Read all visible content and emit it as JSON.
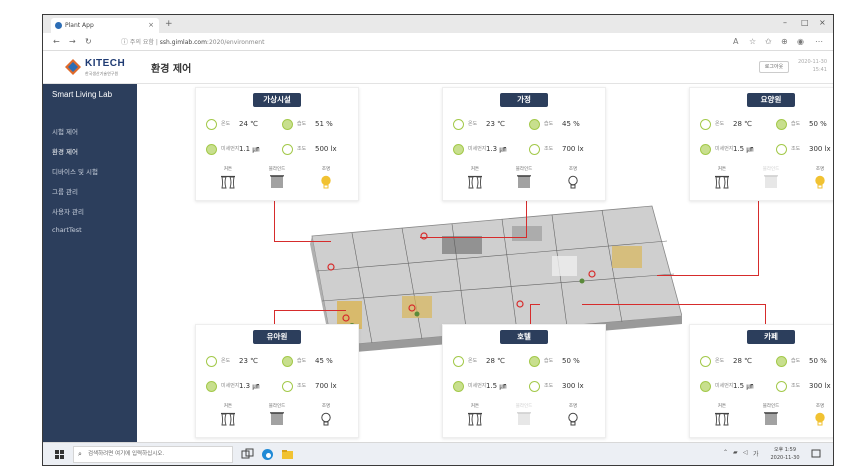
{
  "browser": {
    "tab_title": "Plant App",
    "tab_close": "×",
    "new_tab": "+",
    "window_controls": [
      "–",
      "□",
      "×"
    ],
    "nav": [
      "←",
      "→",
      "↻"
    ],
    "security_text": "주의 요함",
    "url_domain": "ssh.gimlab.com",
    "url_path": ":2020/environment"
  },
  "app": {
    "logo_text": "KITECH",
    "logo_sub": "한국생산기술연구원",
    "page_title": "환경 제어",
    "logout_label": "로그아웃",
    "date_line1": "2020-11-30",
    "date_line2": "15:41"
  },
  "sidebar": {
    "title": "Smart Living Lab",
    "items": [
      {
        "label": "시험 제어"
      },
      {
        "label": "환경 제어"
      },
      {
        "label": "디바이스 및 시험"
      },
      {
        "label": "그룹 관리"
      },
      {
        "label": "사용자 관리"
      },
      {
        "label": "chartTest"
      }
    ],
    "active_index": 1
  },
  "metric_labels": {
    "temp": "온도",
    "humidity": "습도",
    "dust": "미세먼지",
    "illum": "조도"
  },
  "device_labels": {
    "curtain": "커튼",
    "blind": "블라인드",
    "light": "조명"
  },
  "rooms": [
    {
      "name": "가상시설",
      "temp": "24 ℃",
      "humidity": "51 %",
      "dust": "1.1 ㎛",
      "illum": "500 lx",
      "curtain": true,
      "blind": true,
      "light": true,
      "light_on": true
    },
    {
      "name": "가정",
      "temp": "23 ℃",
      "humidity": "45 %",
      "dust": "1.3 ㎛",
      "illum": "700 lx",
      "curtain": true,
      "blind": true,
      "light": true,
      "light_on": false
    },
    {
      "name": "요양원",
      "temp": "28 ℃",
      "humidity": "50 %",
      "dust": "1.5 ㎛",
      "illum": "300 lx",
      "curtain": true,
      "blind": false,
      "light": true,
      "light_on": true
    },
    {
      "name": "유아원",
      "temp": "23 ℃",
      "humidity": "45 %",
      "dust": "1.3 ㎛",
      "illum": "700 lx",
      "curtain": true,
      "blind": true,
      "light": true,
      "light_on": false
    },
    {
      "name": "호텔",
      "temp": "28 ℃",
      "humidity": "50 %",
      "dust": "1.5 ㎛",
      "illum": "300 lx",
      "curtain": true,
      "blind": false,
      "light": true,
      "light_on": false
    },
    {
      "name": "카페",
      "temp": "28 ℃",
      "humidity": "50 %",
      "dust": "1.5 ㎛",
      "illum": "300 lx",
      "curtain": true,
      "blind": true,
      "light": true,
      "light_on": true
    }
  ],
  "taskbar": {
    "search_placeholder": "검색하려면 여기에 입력하십시오.",
    "time": "오후 1:59",
    "date": "2020-11-30"
  },
  "colors": {
    "sidebar": "#2c3e5c",
    "accent": "#a3c94a",
    "connector": "#d62c2c",
    "light_on": "#f1c232"
  }
}
